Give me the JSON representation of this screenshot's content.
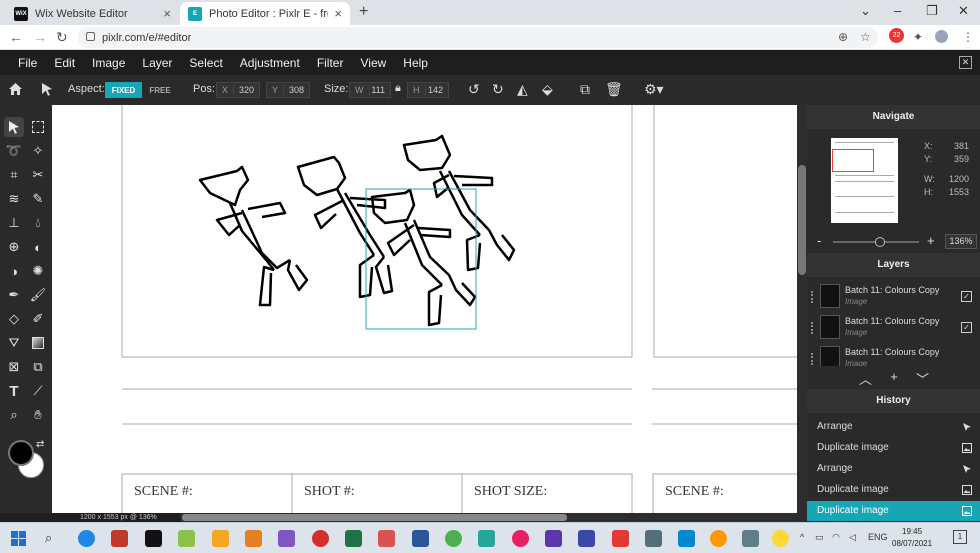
{
  "browser": {
    "tabs": [
      {
        "title": "Wix Website Editor",
        "favicon_text": "WiX",
        "active": false
      },
      {
        "title": "Photo Editor : Pixlr E - free image",
        "favicon_text": "E",
        "active": true
      }
    ],
    "url": "pixlr.com/e/#editor",
    "extension_badge": "22"
  },
  "menu": [
    "File",
    "Edit",
    "Image",
    "Layer",
    "Select",
    "Adjustment",
    "Filter",
    "View",
    "Help"
  ],
  "options": {
    "aspect_label": "Aspect:",
    "fixed_label": "FIXED",
    "free_label": "FREE",
    "pos_label": "Pos:",
    "x_label": "X",
    "x_value": "320",
    "y_label": "Y",
    "y_value": "308",
    "size_label": "Size:",
    "w_label": "W",
    "w_value": "111",
    "h_label": "H",
    "h_value": "142"
  },
  "canvas": {
    "cells": [
      "SCENE #:",
      "SHOT #:",
      "SHOT SIZE:",
      "SCENE #:"
    ],
    "status": "1200 x 1553 px @ 136%"
  },
  "navigate": {
    "title": "Navigate",
    "x_label": "X:",
    "x_value": "381",
    "y_label": "Y:",
    "y_value": "359",
    "w_label": "W:",
    "w_value": "1200",
    "h_label": "H:",
    "h_value": "1553",
    "zoom": "136%"
  },
  "layers": {
    "title": "Layers",
    "items": [
      {
        "name": "Batch 11: Colours Copy",
        "type": "Image"
      },
      {
        "name": "Batch 11: Colours Copy",
        "type": "Image"
      },
      {
        "name": "Batch 11: Colours Copy",
        "type": "Image"
      }
    ]
  },
  "history": {
    "title": "History",
    "items": [
      {
        "label": "Arrange",
        "icon": "cursor-icon"
      },
      {
        "label": "Duplicate image",
        "icon": "image-icon"
      },
      {
        "label": "Arrange",
        "icon": "cursor-icon"
      },
      {
        "label": "Duplicate image",
        "icon": "image-icon"
      },
      {
        "label": "Duplicate image",
        "icon": "image-icon",
        "active": true
      }
    ]
  },
  "taskbar": {
    "lang": "ENG",
    "time": "19:45",
    "date": "08/07/2021",
    "notifications": "1"
  },
  "colors": {
    "accent": "#16a6b6",
    "selection_box": "#2aa3b5",
    "nav_viewport": "#e8443a"
  }
}
